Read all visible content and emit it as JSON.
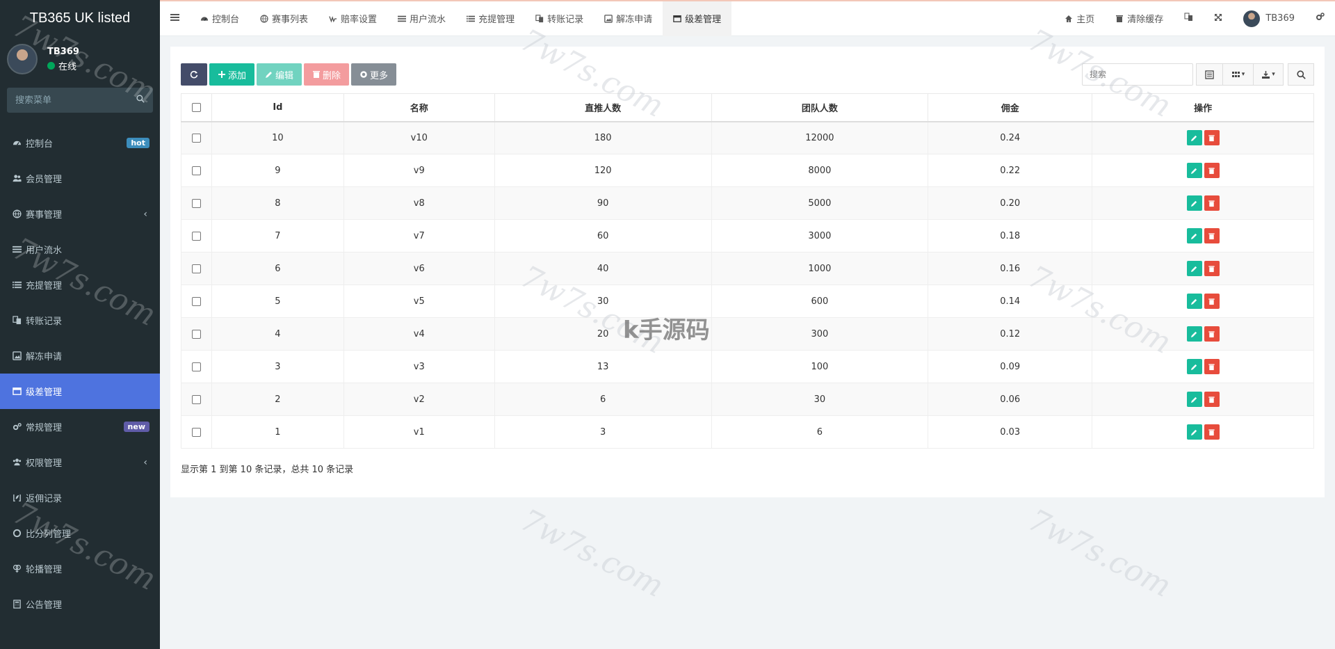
{
  "sidebar": {
    "logo": "TB365 UK listed",
    "user": {
      "name": "TB369",
      "status": "在线"
    },
    "search_placeholder": "搜索菜单",
    "items": [
      {
        "label": "控制台",
        "icon": "dashboard-icon",
        "badge": "hot"
      },
      {
        "label": "会员管理",
        "icon": "users-icon"
      },
      {
        "label": "赛事管理",
        "icon": "globe-icon",
        "chevron": "‹"
      },
      {
        "label": "用户流水",
        "icon": "bars-icon"
      },
      {
        "label": "充提管理",
        "icon": "list-icon"
      },
      {
        "label": "转账记录",
        "icon": "transfer-icon"
      },
      {
        "label": "解冻申请",
        "icon": "image-icon"
      },
      {
        "label": "级差管理",
        "icon": "window-icon",
        "active": true
      },
      {
        "label": "常规管理",
        "icon": "cogs-icon",
        "badge": "new"
      },
      {
        "label": "权限管理",
        "icon": "group-icon",
        "chevron": "‹"
      },
      {
        "label": "返佣记录",
        "icon": "leaf-icon"
      },
      {
        "label": "比分列管理",
        "icon": "circle-icon"
      },
      {
        "label": "轮播管理",
        "icon": "venus-icon"
      },
      {
        "label": "公告管理",
        "icon": "calculator-icon"
      }
    ]
  },
  "topbar": {
    "tabs": [
      "控制台",
      "赛事列表",
      "赔率设置",
      "用户流水",
      "充提管理",
      "转账记录",
      "解冻申请",
      "级差管理"
    ],
    "home": "主页",
    "clear_cache": "清除缓存",
    "username": "TB369"
  },
  "toolbar": {
    "add": "添加",
    "edit": "编辑",
    "delete": "删除",
    "more": "更多",
    "search_placeholder": "搜索"
  },
  "table": {
    "headers": [
      "Id",
      "名称",
      "直推人数",
      "团队人数",
      "佣金",
      "操作"
    ],
    "rows": [
      [
        "10",
        "v10",
        "180",
        "12000",
        "0.24"
      ],
      [
        "9",
        "v9",
        "120",
        "8000",
        "0.22"
      ],
      [
        "8",
        "v8",
        "90",
        "5000",
        "0.20"
      ],
      [
        "7",
        "v7",
        "60",
        "3000",
        "0.18"
      ],
      [
        "6",
        "v6",
        "40",
        "1000",
        "0.16"
      ],
      [
        "5",
        "v5",
        "30",
        "600",
        "0.14"
      ],
      [
        "4",
        "v4",
        "20",
        "300",
        "0.12"
      ],
      [
        "3",
        "v3",
        "13",
        "100",
        "0.09"
      ],
      [
        "2",
        "v2",
        "6",
        "30",
        "0.06"
      ],
      [
        "1",
        "v1",
        "3",
        "6",
        "0.03"
      ]
    ]
  },
  "pagination": "显示第 1 到第 10 条记录，总共 10 条记录",
  "watermark": {
    "text": "7w7s.com",
    "center": "k手源码"
  },
  "colors": {
    "sidebar_bg": "#222d32",
    "active": "#4e73df",
    "success": "#18bc9c",
    "danger": "#e74c3c"
  }
}
